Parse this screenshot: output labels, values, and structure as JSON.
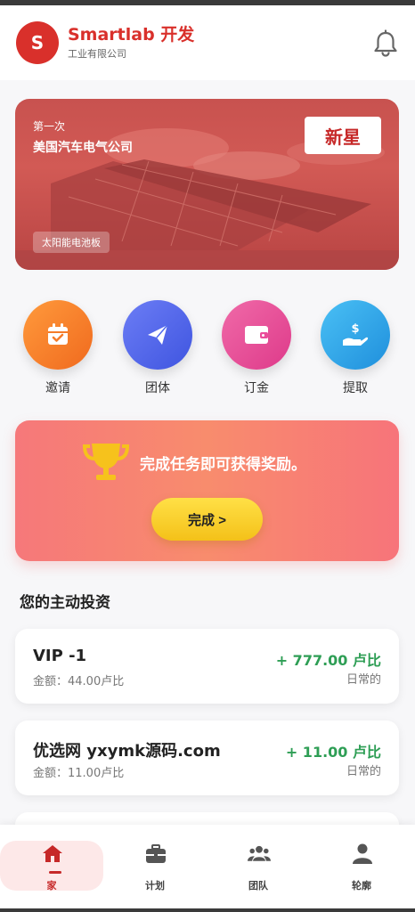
{
  "header": {
    "logo_letter": "S",
    "brand_name": "Smartlab 开发",
    "brand_sub": "工业有限公司",
    "icon": "bell-icon"
  },
  "banner": {
    "small_text": "第一次",
    "company": "美国汽车电气公司",
    "badge": "新星",
    "tag": "太阳能电池板"
  },
  "actions": [
    {
      "label": "邀请",
      "icon": "calendar-check-icon",
      "color": "#f57c2a"
    },
    {
      "label": "团体",
      "icon": "paper-plane-icon",
      "color": "#4f6af0"
    },
    {
      "label": "订金",
      "icon": "wallet-icon",
      "color": "#ea4c9a"
    },
    {
      "label": "提取",
      "icon": "hand-dollar-icon",
      "color": "#2fa8e8"
    }
  ],
  "reward": {
    "text": "完成任务即可获得奖励。",
    "button": "完成 >",
    "icon": "trophy-icon"
  },
  "section_title": "您的主动投资",
  "investments": [
    {
      "name": "VIP -1",
      "amount": "金额：44.00卢比",
      "value": "+ 777.00 卢比",
      "period": "日常的"
    },
    {
      "name": "优选网 yxymk源码.com",
      "amount": "金额：11.00卢比",
      "value": "+ 11.00 卢比",
      "period": "日常的"
    }
  ],
  "nav": [
    {
      "label": "家",
      "icon": "home-icon",
      "active": true
    },
    {
      "label": "计划",
      "icon": "briefcase-icon",
      "active": false
    },
    {
      "label": "团队",
      "icon": "users-icon",
      "active": false
    },
    {
      "label": "轮廓",
      "icon": "user-icon",
      "active": false
    }
  ],
  "colors": {
    "brand": "#d9302b",
    "positive": "#2e9e55",
    "reward_button": "#f4c119"
  }
}
